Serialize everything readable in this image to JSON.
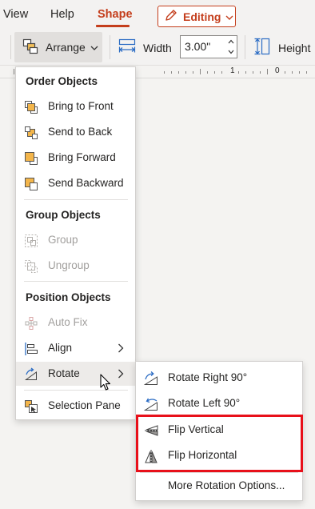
{
  "ribbon": {
    "tabs": [
      {
        "label": "View",
        "active": false
      },
      {
        "label": "Help",
        "active": false
      },
      {
        "label": "Shape",
        "active": true
      }
    ],
    "mode_button": {
      "label": "Editing",
      "icon": "pencil-icon"
    },
    "arrange_button": {
      "label": "Arrange",
      "icon": "arrange-icon"
    },
    "width": {
      "label": "Width",
      "value": "3.00\"",
      "icon": "width-icon"
    },
    "height": {
      "label": "Height",
      "icon": "height-icon"
    },
    "accent_color": "#c43e1c"
  },
  "ruler": {
    "labels": [
      "1",
      "0"
    ]
  },
  "arrange_menu": {
    "sections": [
      {
        "heading": "Order Objects",
        "items": [
          {
            "label": "Bring to Front",
            "icon": "bring-to-front-icon",
            "disabled": false
          },
          {
            "label": "Send to Back",
            "icon": "send-to-back-icon",
            "disabled": false
          },
          {
            "label": "Bring Forward",
            "icon": "bring-forward-icon",
            "disabled": false
          },
          {
            "label": "Send Backward",
            "icon": "send-backward-icon",
            "disabled": false
          }
        ]
      },
      {
        "heading": "Group Objects",
        "items": [
          {
            "label": "Group",
            "icon": "group-icon",
            "disabled": true
          },
          {
            "label": "Ungroup",
            "icon": "ungroup-icon",
            "disabled": true
          }
        ]
      },
      {
        "heading": "Position Objects",
        "items": [
          {
            "label": "Auto Fix",
            "icon": "auto-fix-icon",
            "disabled": true
          },
          {
            "label": "Align",
            "icon": "align-icon",
            "disabled": false,
            "submenu": true
          },
          {
            "label": "Rotate",
            "icon": "rotate-icon",
            "disabled": false,
            "submenu": true,
            "highlighted": true
          }
        ]
      }
    ],
    "footer_item": {
      "label": "Selection Pane",
      "icon": "selection-pane-icon"
    }
  },
  "rotate_submenu": {
    "items": [
      {
        "label": "Rotate Right 90°",
        "icon": "rotate-right-icon"
      },
      {
        "label": "Rotate Left 90°",
        "icon": "rotate-left-icon"
      },
      {
        "label": "Flip Vertical",
        "icon": "flip-vertical-icon"
      },
      {
        "label": "Flip Horizontal",
        "icon": "flip-horizontal-icon"
      }
    ],
    "more_options": "More Rotation Options...",
    "highlight_color": "#e8101a"
  }
}
